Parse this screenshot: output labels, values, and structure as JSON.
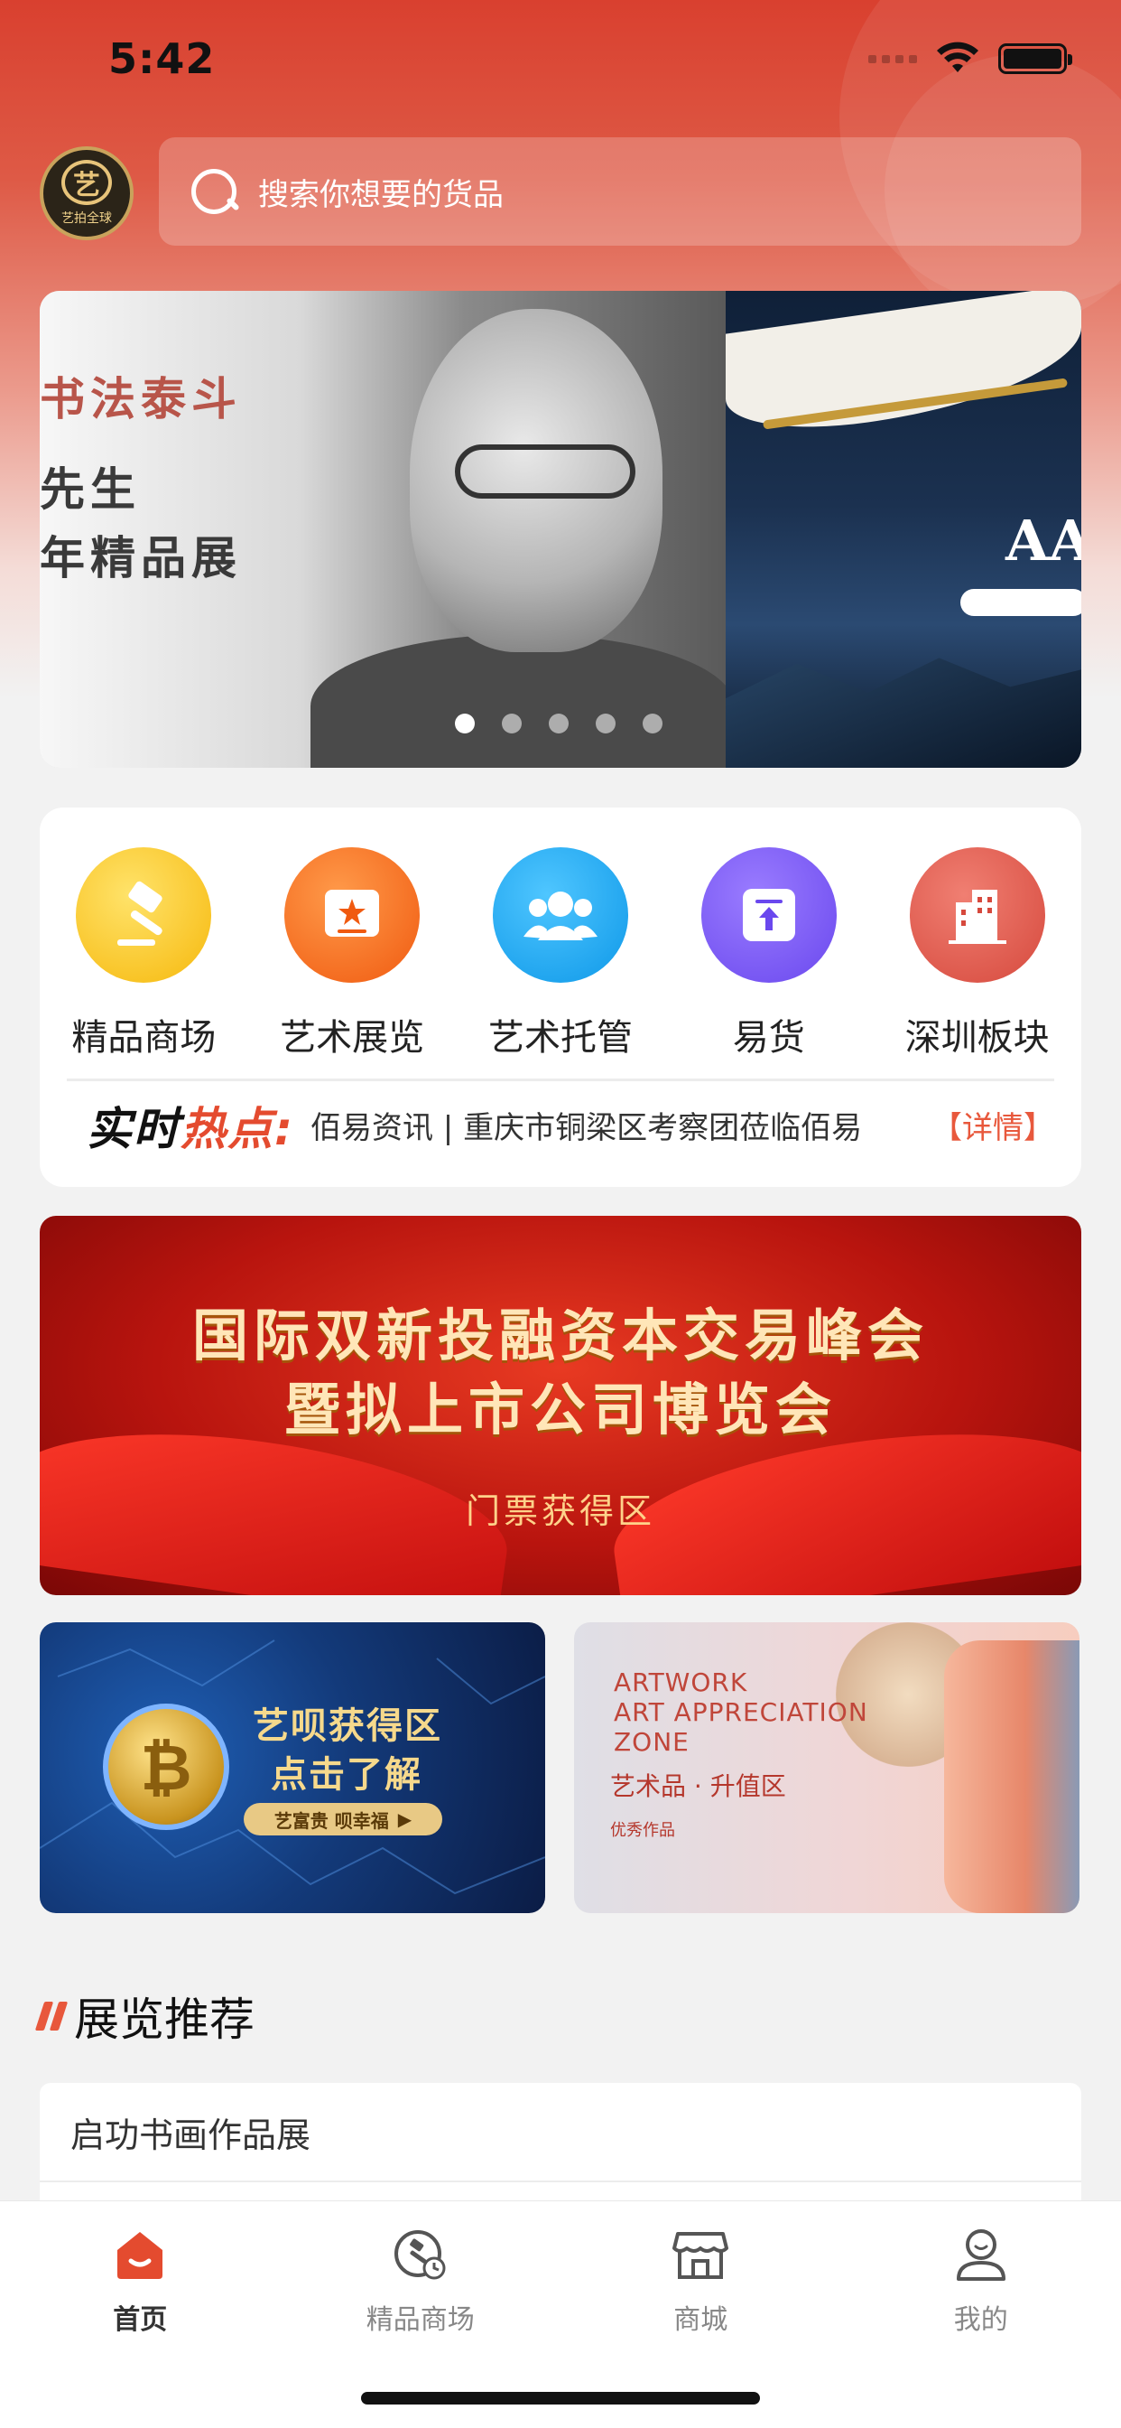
{
  "status_bar": {
    "time": "5:42"
  },
  "header": {
    "logo_text": "艺拍全球",
    "logo_mark": "艺",
    "search": {
      "placeholder": "搜索你想要的货品"
    }
  },
  "banner": {
    "slide1_lines": [
      "书法泰斗",
      "先生",
      "年精品展"
    ],
    "slide2_text": "AA",
    "dot_count": 5,
    "active_dot": 0
  },
  "menu": {
    "items": [
      {
        "label": "精品商场",
        "icon": "auction-hammer-icon",
        "color": "#f9c41d"
      },
      {
        "label": "艺术展览",
        "icon": "exhibition-star-icon",
        "color": "#f56a1c"
      },
      {
        "label": "艺术托管",
        "icon": "users-icon",
        "color": "#1aa5f0"
      },
      {
        "label": "易货",
        "icon": "upload-box-icon",
        "color": "#7a5cf0"
      },
      {
        "label": "深圳板块",
        "icon": "building-icon",
        "color": "#e0564b"
      }
    ]
  },
  "hotspot": {
    "title_black": "实时",
    "title_red": "热点",
    "colon": ":",
    "text": "佰易资讯 | 重庆市铜梁区考察团莅临佰易",
    "more": "【详情】"
  },
  "promo": {
    "line1": "国际双新投融资本交易峰会",
    "line2": "暨拟上市公司博览会",
    "line3": "门票获得区"
  },
  "tiles": {
    "left": {
      "line1": "艺呗获得区",
      "line2": "点击了解",
      "pill": "艺富贵 呗幸福"
    },
    "right": {
      "en": [
        "ARTWORK",
        "ART APPRECIATION",
        "ZONE"
      ],
      "line1": "艺术品 · 升值区",
      "line2": "优秀作品"
    }
  },
  "section": {
    "title": "展览推荐",
    "items": [
      "启功书画作品展"
    ]
  },
  "tabbar": {
    "tabs": [
      {
        "label": "首页",
        "icon": "home-icon",
        "active": true
      },
      {
        "label": "精品商场",
        "icon": "auction-clock-icon",
        "active": false
      },
      {
        "label": "商城",
        "icon": "store-icon",
        "active": false
      },
      {
        "label": "我的",
        "icon": "profile-icon",
        "active": false
      }
    ]
  },
  "colors": {
    "accent": "#e44b2f",
    "header_red": "#d9402f"
  }
}
